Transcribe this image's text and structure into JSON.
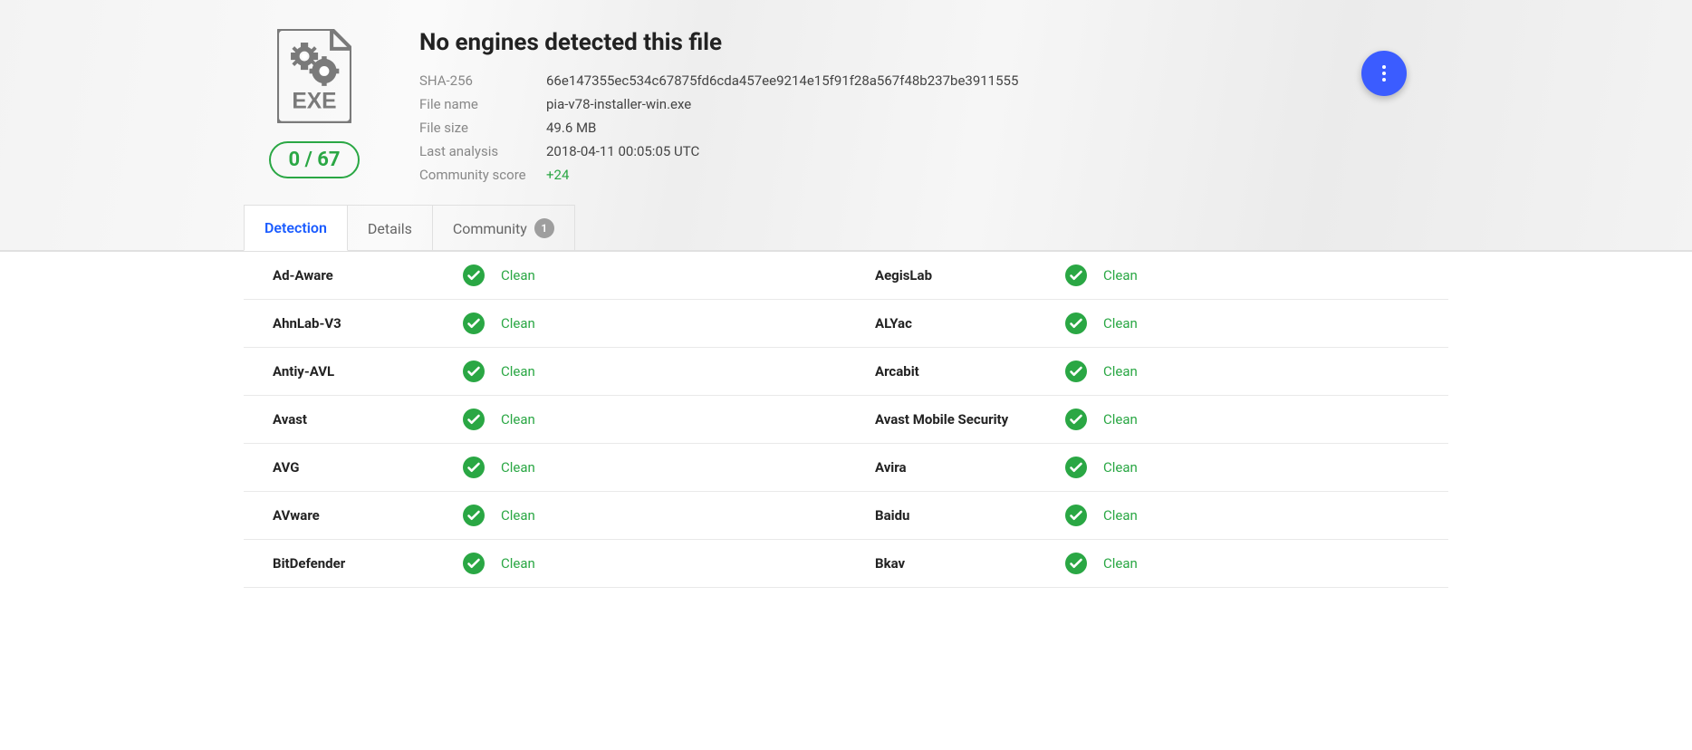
{
  "summary": {
    "title": "No engines detected this file",
    "detection_ratio": "0 / 67",
    "meta": {
      "sha256_label": "SHA-256",
      "sha256": "66e147355ec534c67875fd6cda457ee9214e15f91f28a567f48b237be3911555",
      "filename_label": "File name",
      "filename": "pia-v78-installer-win.exe",
      "filesize_label": "File size",
      "filesize": "49.6 MB",
      "lastanalysis_label": "Last analysis",
      "lastanalysis": "2018-04-11 00:05:05 UTC",
      "community_label": "Community score",
      "community_score": "+24"
    }
  },
  "tabs": {
    "detection": "Detection",
    "details": "Details",
    "community": "Community",
    "community_count": "1"
  },
  "detections": [
    {
      "left": {
        "vendor": "Ad-Aware",
        "result": "Clean"
      },
      "right": {
        "vendor": "AegisLab",
        "result": "Clean"
      }
    },
    {
      "left": {
        "vendor": "AhnLab-V3",
        "result": "Clean"
      },
      "right": {
        "vendor": "ALYac",
        "result": "Clean"
      }
    },
    {
      "left": {
        "vendor": "Antiy-AVL",
        "result": "Clean"
      },
      "right": {
        "vendor": "Arcabit",
        "result": "Clean"
      }
    },
    {
      "left": {
        "vendor": "Avast",
        "result": "Clean"
      },
      "right": {
        "vendor": "Avast Mobile Security",
        "result": "Clean"
      }
    },
    {
      "left": {
        "vendor": "AVG",
        "result": "Clean"
      },
      "right": {
        "vendor": "Avira",
        "result": "Clean"
      }
    },
    {
      "left": {
        "vendor": "AVware",
        "result": "Clean"
      },
      "right": {
        "vendor": "Baidu",
        "result": "Clean"
      }
    },
    {
      "left": {
        "vendor": "BitDefender",
        "result": "Clean"
      },
      "right": {
        "vendor": "Bkav",
        "result": "Clean"
      }
    }
  ]
}
